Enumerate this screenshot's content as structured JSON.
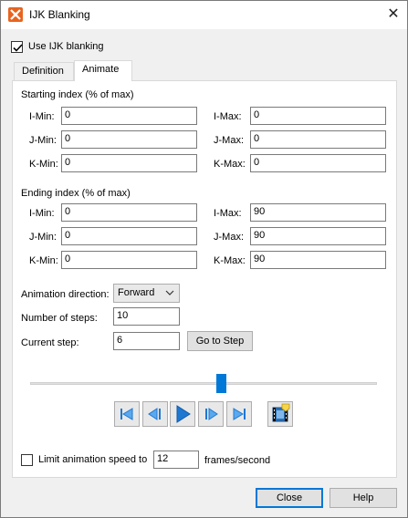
{
  "window": {
    "title": "IJK Blanking",
    "close_symbol": "✕"
  },
  "use_ijk": {
    "label": "Use IJK blanking",
    "checked": true
  },
  "tabs": [
    {
      "label": "Definition",
      "active": false
    },
    {
      "label": "Animate",
      "active": true
    }
  ],
  "starting": {
    "heading": "Starting index (% of max)",
    "i_min_label": "I-Min:",
    "i_min": "0",
    "j_min_label": "J-Min:",
    "j_min": "0",
    "k_min_label": "K-Min:",
    "k_min": "0",
    "i_max_label": "I-Max:",
    "i_max": "0",
    "j_max_label": "J-Max:",
    "j_max": "0",
    "k_max_label": "K-Max:",
    "k_max": "0"
  },
  "ending": {
    "heading": "Ending index (% of max)",
    "i_min_label": "I-Min:",
    "i_min": "0",
    "j_min_label": "J-Min:",
    "j_min": "0",
    "k_min_label": "K-Min:",
    "k_min": "0",
    "i_max_label": "I-Max:",
    "i_max": "90",
    "j_max_label": "J-Max:",
    "j_max": "90",
    "k_max_label": "K-Max:",
    "k_max": "90"
  },
  "animation": {
    "direction_label": "Animation direction:",
    "direction_value": "Forward",
    "steps_label": "Number of steps:",
    "steps_value": "10",
    "current_label": "Current step:",
    "current_value": "6",
    "go_button": "Go to Step",
    "slider_fraction": 0.55
  },
  "playback": {
    "icons": [
      "skip-to-start-icon",
      "step-back-icon",
      "play-icon",
      "step-forward-icon",
      "skip-to-end-icon",
      "film-settings-icon"
    ]
  },
  "speed": {
    "label": "Limit animation speed to",
    "checked": false,
    "value": "12",
    "unit": "frames/second"
  },
  "buttons": {
    "close": "Close",
    "help": "Help"
  },
  "colors": {
    "accent": "#0078d7",
    "app_icon": "#e8641e",
    "play": "#1e78d2"
  }
}
